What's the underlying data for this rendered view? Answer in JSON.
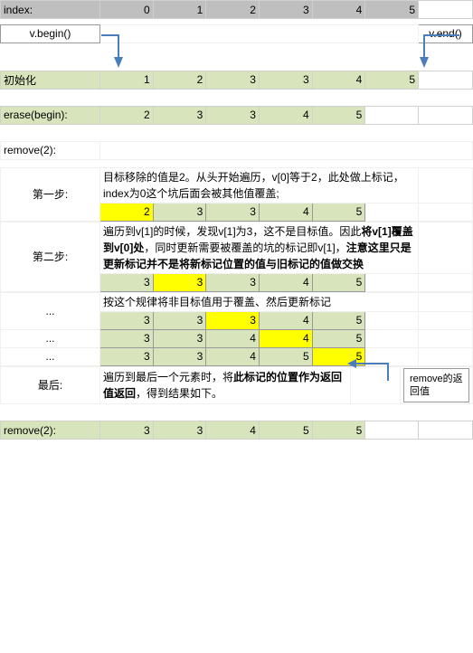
{
  "header": {
    "label": "index:",
    "cols": [
      "0",
      "1",
      "2",
      "3",
      "4",
      "5"
    ]
  },
  "vbegin": "v.begin()",
  "vend": "v.end()",
  "init": {
    "label": "初始化",
    "vals": [
      "1",
      "2",
      "3",
      "3",
      "4",
      "5"
    ]
  },
  "eraseBegin": {
    "label": "erase(begin):",
    "vals": [
      "2",
      "3",
      "3",
      "4",
      "5"
    ]
  },
  "remove2Label": "remove(2):",
  "step1": {
    "label": "第一步:",
    "desc": "目标移除的值是2。从头开始遍历，v[0]等于2，此处做上标记，index为0这个坑后面会被其他值覆盖;",
    "vals": [
      "2",
      "3",
      "3",
      "4",
      "5"
    ]
  },
  "step2": {
    "label": "第二步:",
    "descA": "遍历到v[1]的时候，发现v[1]为3，这不是目标值。因此",
    "descB": "将v[1]覆盖到v[0]处",
    "descC": "，同时更新需要被覆盖的坑的标记即v[1]，",
    "descD": "注意这里只是更新标记并不是将新标记位置的值与旧标记的值做交换",
    "vals": [
      "3",
      "3",
      "3",
      "4",
      "5"
    ]
  },
  "stepDots": {
    "label": "...",
    "desc": "按这个规律将非目标值用于覆盖、然后更新标记",
    "r1": [
      "3",
      "3",
      "3",
      "4",
      "5"
    ],
    "r2": [
      "3",
      "3",
      "4",
      "4",
      "5"
    ],
    "r3": [
      "3",
      "3",
      "4",
      "5",
      "5"
    ]
  },
  "stepLast": {
    "label": "最后:",
    "descA": "遍历到最后一个元素时，将",
    "descB": "此标记的位置作为返回值返回",
    "descC": "，得到结果如下。"
  },
  "removeBox": "remove的返回值",
  "removeResult": {
    "label": "remove(2):",
    "vals": [
      "3",
      "3",
      "4",
      "5",
      "5"
    ]
  }
}
